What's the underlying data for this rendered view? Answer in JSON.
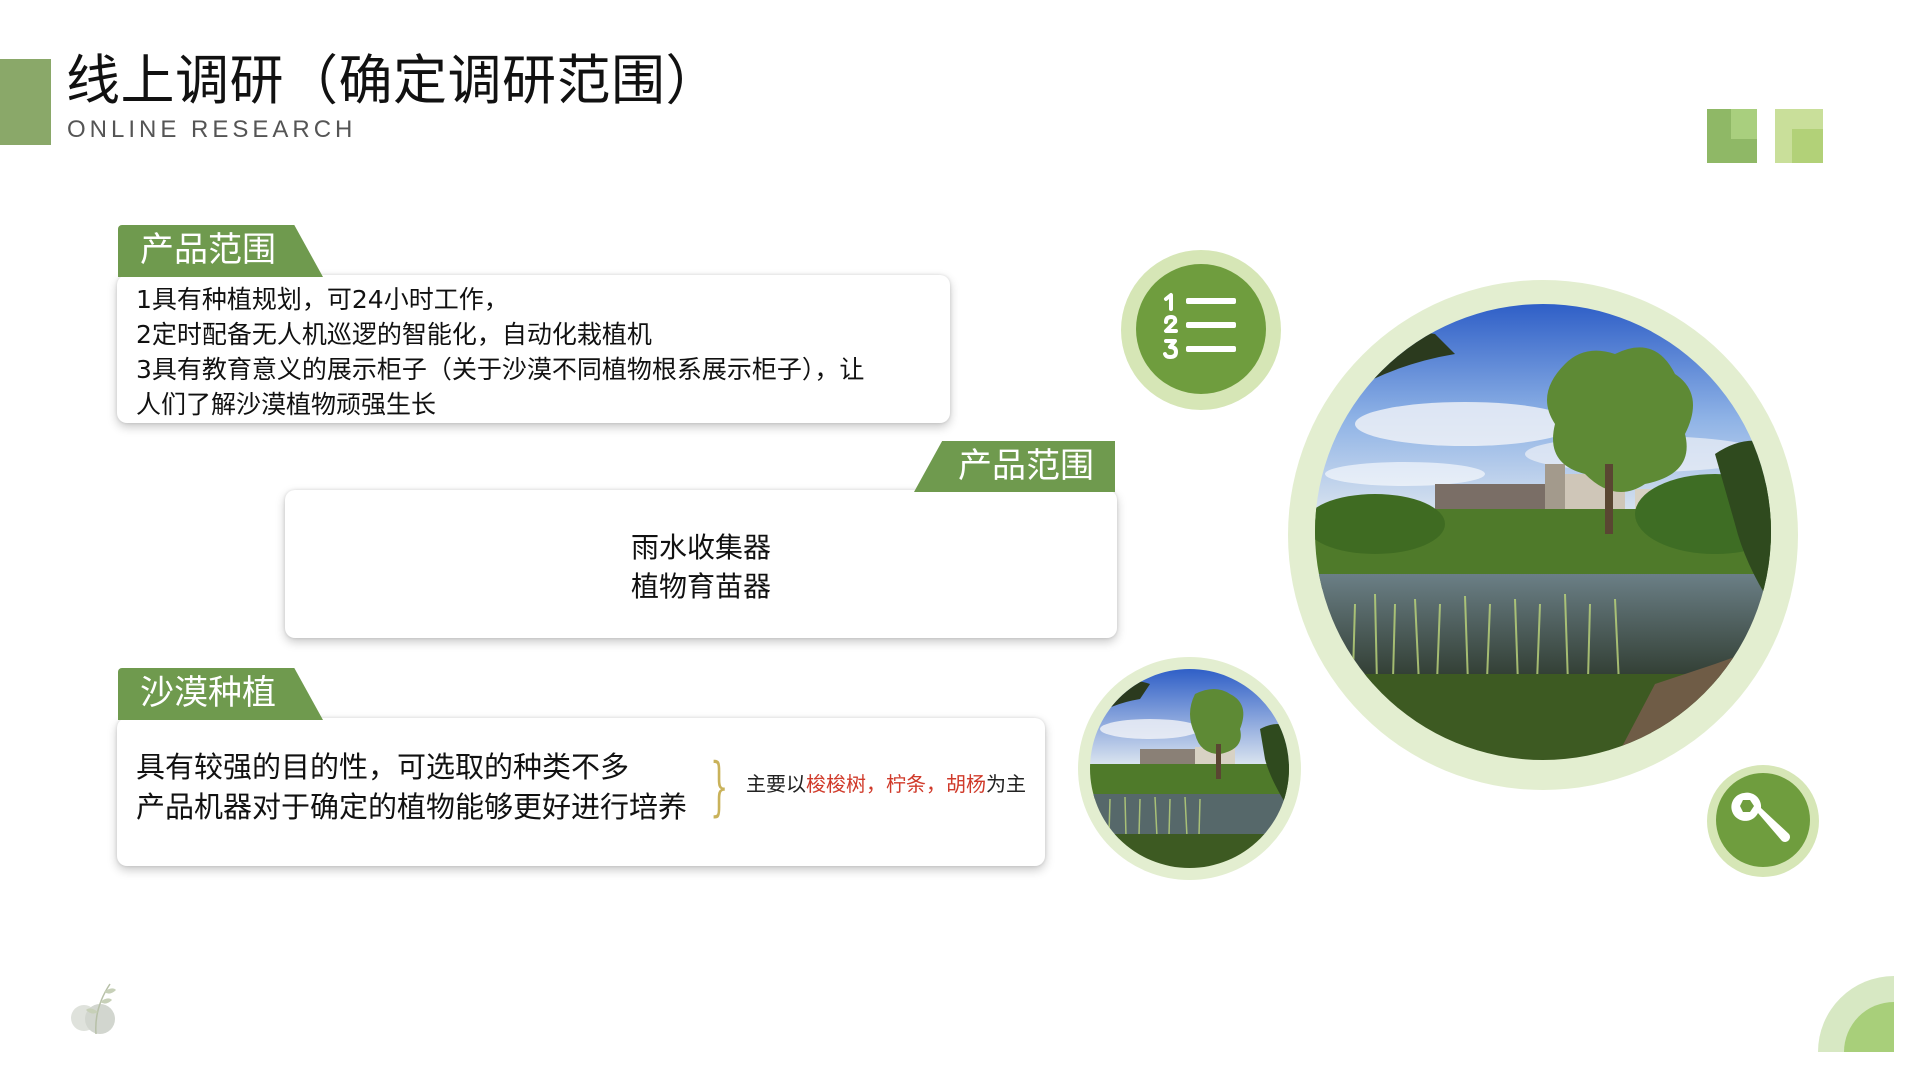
{
  "header": {
    "title": "线上调研（确定调研范围）",
    "subtitle": "ONLINE RESEARCH"
  },
  "cards": [
    {
      "tab_label": "产品范围",
      "lines": [
        "1具有种植规划，可24小时工作，",
        "2定时配备无人机巡逻的智能化，自动化栽植机",
        "3具有教育意义的展示柜子（关于沙漠不同植物根系展示柜子），让",
        "人们了解沙漠植物顽强生长"
      ]
    },
    {
      "tab_label": "产品范围",
      "lines": [
        "雨水收集器",
        "植物育苗器"
      ]
    },
    {
      "tab_label": "沙漠种植",
      "lines": [
        "具有较强的目的性，可选取的种类不多",
        "产品机器对于确定的植物能够更好进行培养"
      ],
      "note": {
        "prefix": "主要以",
        "highlight": "梭梭树，柠条，胡杨",
        "suffix": "为主"
      }
    }
  ],
  "icons": {
    "list": "numbered-list-icon",
    "tool": "wrench-icon",
    "leaf": "leaf-icon"
  },
  "colors": {
    "accent": "#8aa869",
    "tab_green": "#6f9a4e",
    "icon_green": "#6f9d3e",
    "ring_green": "#e3eed0",
    "highlight_red": "#d03a2a"
  }
}
